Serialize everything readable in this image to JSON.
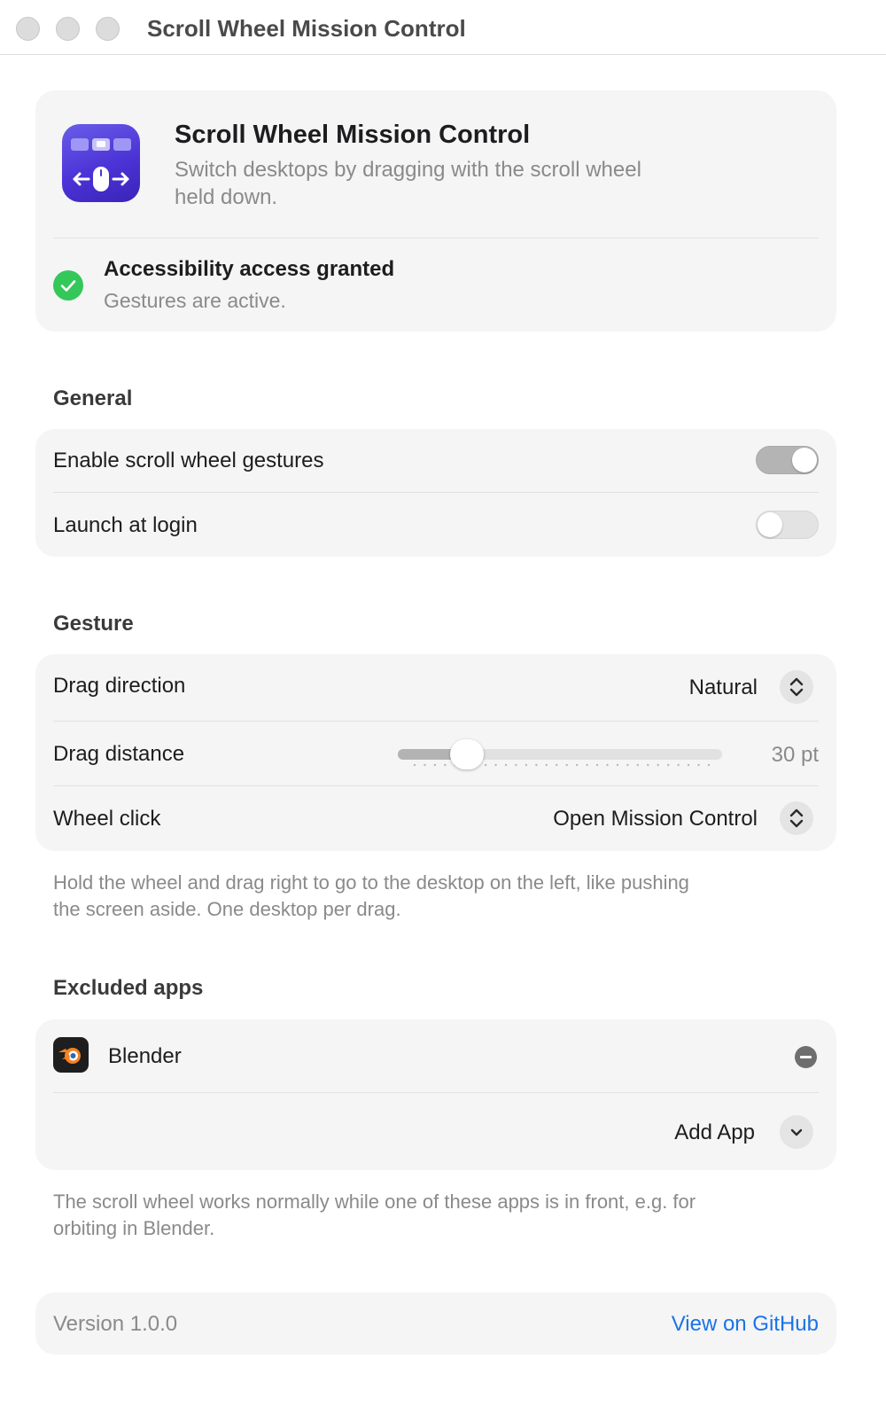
{
  "window": {
    "title": "Scroll Wheel Mission Control"
  },
  "header": {
    "app_name": "Scroll Wheel Mission Control",
    "description_line1": "Switch desktops by dragging with the scroll wheel",
    "description_line2": "held down.",
    "app_icon": "scroll-wheel-app-icon",
    "accent_color": "#5a48e0"
  },
  "status": {
    "title": "Accessibility access granted",
    "subtitle": "Gestures are active.",
    "icon": "checkmark-circle-icon",
    "color": "#34c759"
  },
  "general": {
    "title": "General",
    "rows": [
      {
        "label": "Enable scroll wheel gestures",
        "value": true
      },
      {
        "label": "Launch at login",
        "value": false
      }
    ]
  },
  "gesture": {
    "title": "Gesture",
    "drag_direction": {
      "label": "Drag direction",
      "value": "Natural"
    },
    "drag_distance": {
      "label": "Drag distance",
      "value_text": "30 pt",
      "fraction": 0.18
    },
    "wheel_click": {
      "label": "Wheel click",
      "value": "Open Mission Control"
    },
    "note_line1": "Hold the wheel and drag right to go to the desktop on the left, like pushing",
    "note_line2": "the screen aside. One desktop per drag."
  },
  "excluded": {
    "title": "Excluded apps",
    "apps": [
      {
        "name": "Blender",
        "icon": "blender-icon"
      }
    ],
    "add_label": "Add App",
    "note_line1": "The scroll wheel works normally while one of these apps is in front, e.g. for",
    "note_line2": "orbiting in Blender."
  },
  "footer": {
    "version": "Version 1.0.0",
    "link": "View on GitHub",
    "link_color": "#1a73e8"
  }
}
